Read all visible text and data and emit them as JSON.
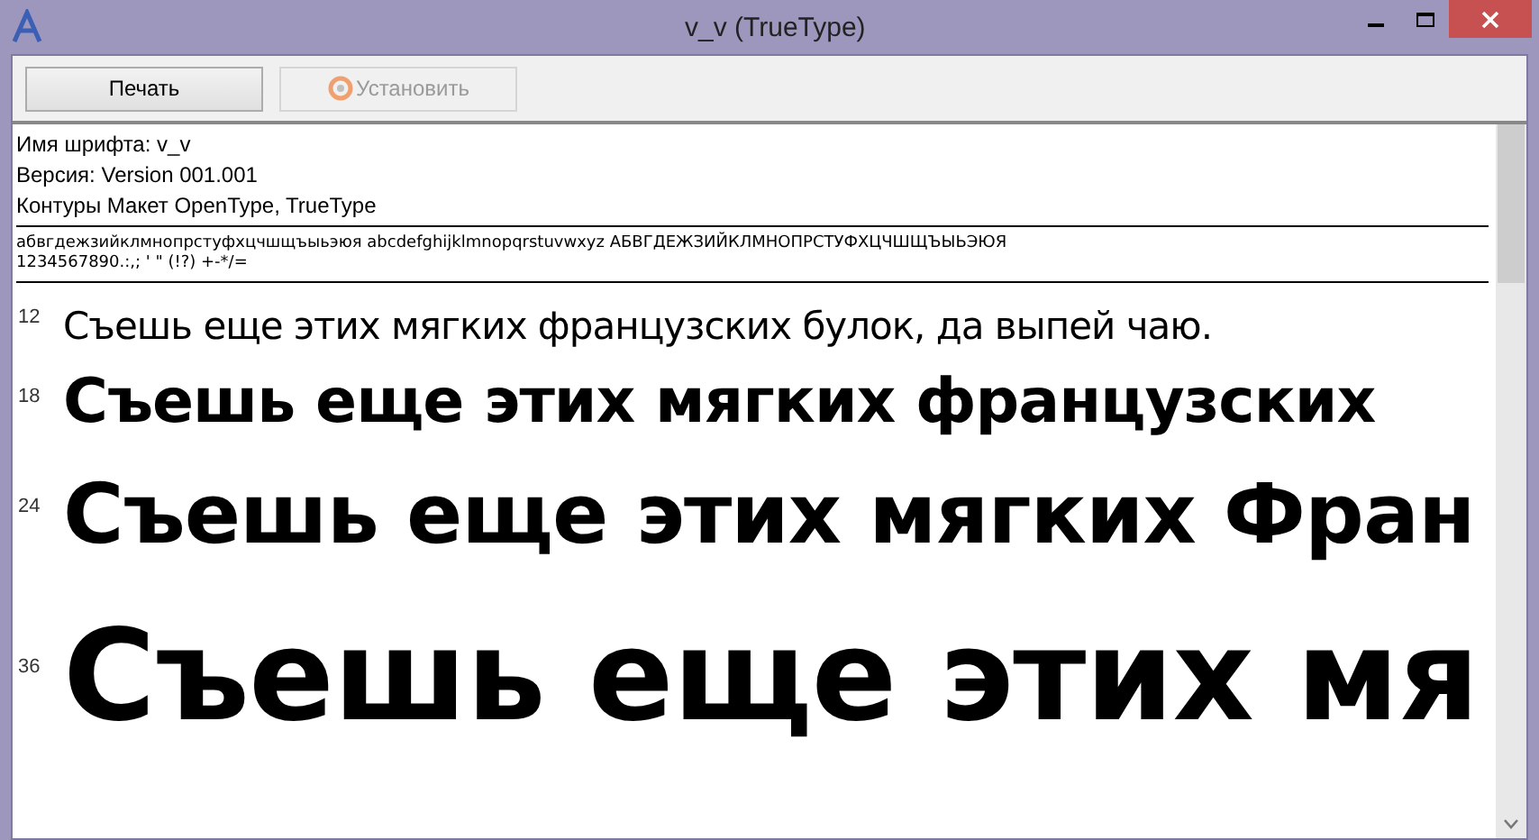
{
  "window": {
    "title": "v_v (TrueType)"
  },
  "buttons": [
    {
      "label": "Печать",
      "disabled": false,
      "icon": false
    },
    {
      "label": "Установить",
      "disabled": true,
      "icon": true
    }
  ],
  "info": [
    "Имя шрифта: v_v",
    "Версия: Version 001.001",
    "Контуры Макет OpenType, TrueType"
  ],
  "charset": [
    "абвгдежзийклмнопрстуфхцчшщъыьэюя abcdefghijklmnopqrstuvwxyz АБВГДЕЖЗИЙКЛМНОПРСТУФХЦЧШЩЪЫЬЭЮЯ",
    "1234567890.:,; ' \" (!?) +-*/="
  ],
  "samples": [
    {
      "size": "12",
      "text": "Съешь еще этих мягких французских булок, да выпей чаю."
    },
    {
      "size": "18",
      "text": "Съешь еще этих мягких французских"
    },
    {
      "size": "24",
      "text": "Съешь еще этих мягких Фран"
    },
    {
      "size": "36",
      "text": "Съешь еще этих мя"
    }
  ]
}
